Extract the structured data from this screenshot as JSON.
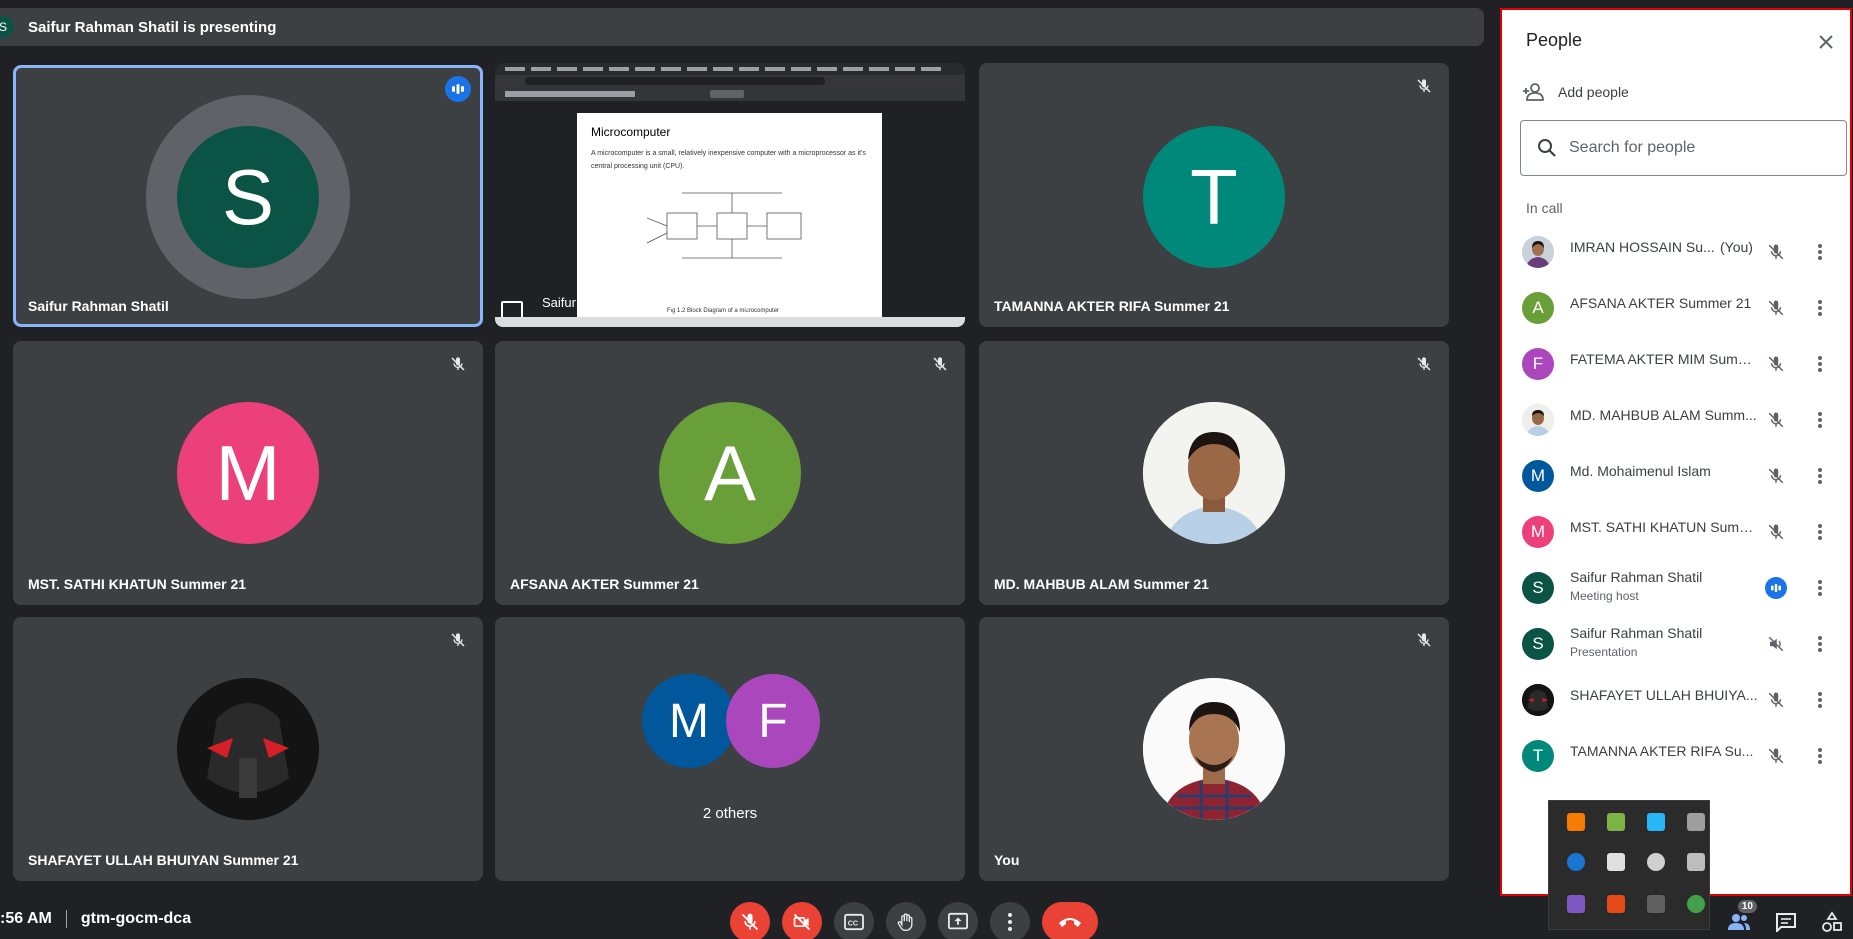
{
  "presenting": {
    "avatar": "S",
    "text": "Saifur Rahman Shatil is presenting"
  },
  "tiles": [
    {
      "name": "Saifur Rahman Shatil",
      "initial": "S",
      "color": "#0b5345",
      "speaking": true
    },
    {
      "name": "Saifur Rahman Shatil (Presentation)"
    },
    {
      "name": "TAMANNA AKTER RIFA Summer 21",
      "initial": "T",
      "color": "#00897b"
    },
    {
      "name": "MST. SATHI KHATUN Summer 21",
      "initial": "M",
      "color": "#ec407a"
    },
    {
      "name": "AFSANA AKTER Summer 21",
      "initial": "A",
      "color": "#689f38"
    },
    {
      "name": "MD. MAHBUB ALAM Summer 21"
    },
    {
      "name": "SHAFAYET ULLAH BHUIYAN Summer 21"
    },
    {
      "others": "2 others",
      "initials": [
        "M",
        "F"
      ]
    },
    {
      "name": "You"
    }
  ],
  "slide": {
    "title": "Microcomputer",
    "bullet_1": "A microcomputer is a small, relatively inexpensive computer with a microprocessor as it's central processing unit (CPU).",
    "caption": "Fig 1.2 Block Diagram of a microcomputer"
  },
  "meeting": {
    "time": ":56 AM",
    "code": "gtm-gocm-dca"
  },
  "people_count": "10",
  "panel": {
    "title": "People",
    "add_people": "Add people",
    "search_placeholder": "Search for people",
    "in_call": "In call",
    "participants": [
      {
        "name": "IMRAN HOSSAIN Su...",
        "you": "(You)",
        "initial": "",
        "photo": true
      },
      {
        "name": "AFSANA AKTER Summer 21",
        "initial": "A",
        "color": "#689f38"
      },
      {
        "name": "FATEMA AKTER MIM Summ...",
        "initial": "F",
        "color": "#ab47bc"
      },
      {
        "name": "MD. MAHBUB ALAM Summ...",
        "initial": "",
        "photo": true
      },
      {
        "name": "Md. Mohaimenul Islam",
        "initial": "M",
        "color": "#01579b"
      },
      {
        "name": "MST. SATHI KHATUN Summ...",
        "initial": "M",
        "color": "#ec407a"
      },
      {
        "name": "Saifur Rahman Shatil",
        "sub": "Meeting host",
        "initial": "S",
        "color": "#0b5345"
      },
      {
        "name": "Saifur Rahman Shatil",
        "sub": "Presentation",
        "initial": "S",
        "color": "#0b5345"
      },
      {
        "name": "SHAFAYET ULLAH BHUIYA...",
        "initial": "",
        "photo": true
      },
      {
        "name": "TAMANNA AKTER RIFA Su...",
        "initial": "T",
        "color": "#00897b"
      }
    ]
  }
}
